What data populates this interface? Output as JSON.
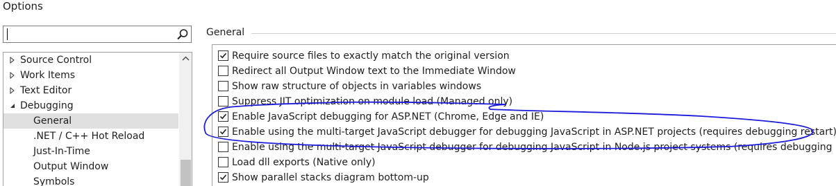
{
  "window": {
    "title": "Options"
  },
  "search": {
    "value": "",
    "placeholder": ""
  },
  "tree": {
    "items": [
      {
        "label": "Source Control",
        "arrow": "expand",
        "level": 0,
        "selected": false
      },
      {
        "label": "Work Items",
        "arrow": "expand",
        "level": 0,
        "selected": false
      },
      {
        "label": "Text Editor",
        "arrow": "expand",
        "level": 0,
        "selected": false
      },
      {
        "label": "Debugging",
        "arrow": "collapse",
        "level": 0,
        "selected": false
      },
      {
        "label": "General",
        "arrow": "none",
        "level": 1,
        "selected": true
      },
      {
        "label": ".NET / C++ Hot Reload",
        "arrow": "none",
        "level": 1,
        "selected": false
      },
      {
        "label": "Just-In-Time",
        "arrow": "none",
        "level": 1,
        "selected": false
      },
      {
        "label": "Output Window",
        "arrow": "none",
        "level": 1,
        "selected": false
      },
      {
        "label": "Symbols",
        "arrow": "none",
        "level": 1,
        "selected": false
      }
    ]
  },
  "section": {
    "title": "General"
  },
  "options": [
    {
      "label": "Require source files to exactly match the original version",
      "checked": true
    },
    {
      "label": "Redirect all Output Window text to the Immediate Window",
      "checked": false
    },
    {
      "label": "Show raw structure of objects in variables windows",
      "checked": false
    },
    {
      "label": "Suppress JIT optimization on module load (Managed only)",
      "checked": false
    },
    {
      "label": "Enable JavaScript debugging for ASP.NET (Chrome, Edge and IE)",
      "checked": true
    },
    {
      "label": "Enable using the multi-target JavaScript debugger for debugging JavaScript in ASP.NET projects (requires debugging restart)",
      "checked": true
    },
    {
      "label": "Enable using the multi-target JavaScript debugger for debugging JavaScript in Node.js project systems (requires debugging restart)",
      "checked": false
    },
    {
      "label": "Load dll exports (Native only)",
      "checked": false
    },
    {
      "label": "Show parallel stacks diagram bottom-up",
      "checked": true
    }
  ],
  "colors": {
    "annotation": "#1a1adb",
    "selection": "#e0e0e0",
    "border": "#a0a0a0"
  },
  "icons": {
    "search": "search-icon",
    "expand": "expand-arrow-icon",
    "collapse": "collapse-arrow-icon",
    "check": "check-icon"
  }
}
